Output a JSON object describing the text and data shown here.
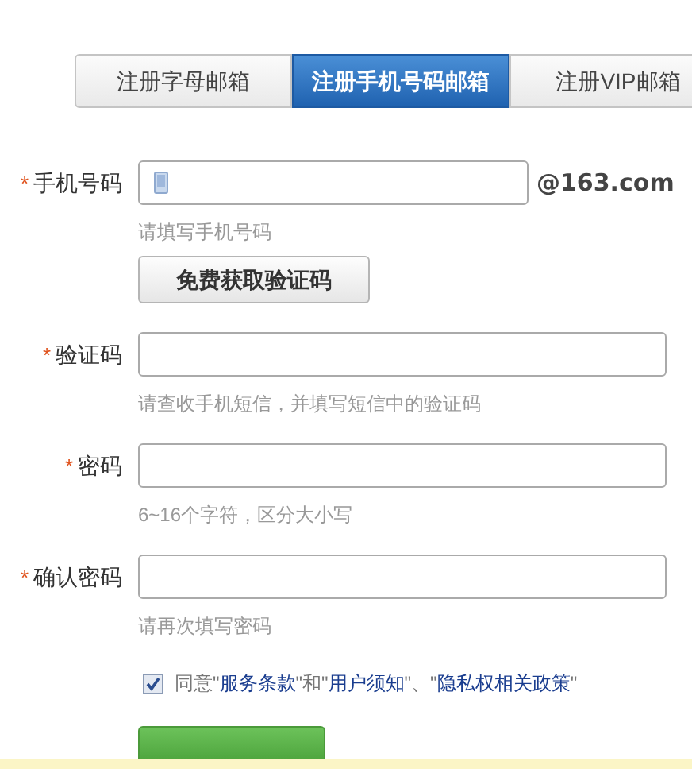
{
  "tabs": [
    {
      "label": "注册字母邮箱",
      "selected": false
    },
    {
      "label": "注册手机号码邮箱",
      "selected": true
    },
    {
      "label": "注册VIP邮箱",
      "selected": false
    }
  ],
  "fields": [
    {
      "kind": "phone",
      "label": "手机号码",
      "marker": "*",
      "suffix": "@163.com",
      "hint": "请填写手机号码",
      "button": "免费获取验证码"
    },
    {
      "kind": "text",
      "label": "验证码",
      "marker": "*",
      "hint": "请查收手机短信，并填写短信中的验证码"
    },
    {
      "kind": "text",
      "label": "密码",
      "marker": "*",
      "hint": "6~16个字符，区分大小写"
    },
    {
      "kind": "text",
      "label": "确认密码",
      "marker": "*",
      "hint": "请再次填写密码"
    }
  ],
  "agreement": {
    "checked": true,
    "parts": [
      {
        "kind": "text",
        "text": "同意\""
      },
      {
        "kind": "link",
        "text": "服务条款"
      },
      {
        "kind": "text",
        "text": "\"和\""
      },
      {
        "kind": "link",
        "text": "用户须知"
      },
      {
        "kind": "text",
        "text": "\"、\""
      },
      {
        "kind": "link",
        "text": "隐私权相关政策"
      },
      {
        "kind": "text",
        "text": "\""
      }
    ]
  }
}
